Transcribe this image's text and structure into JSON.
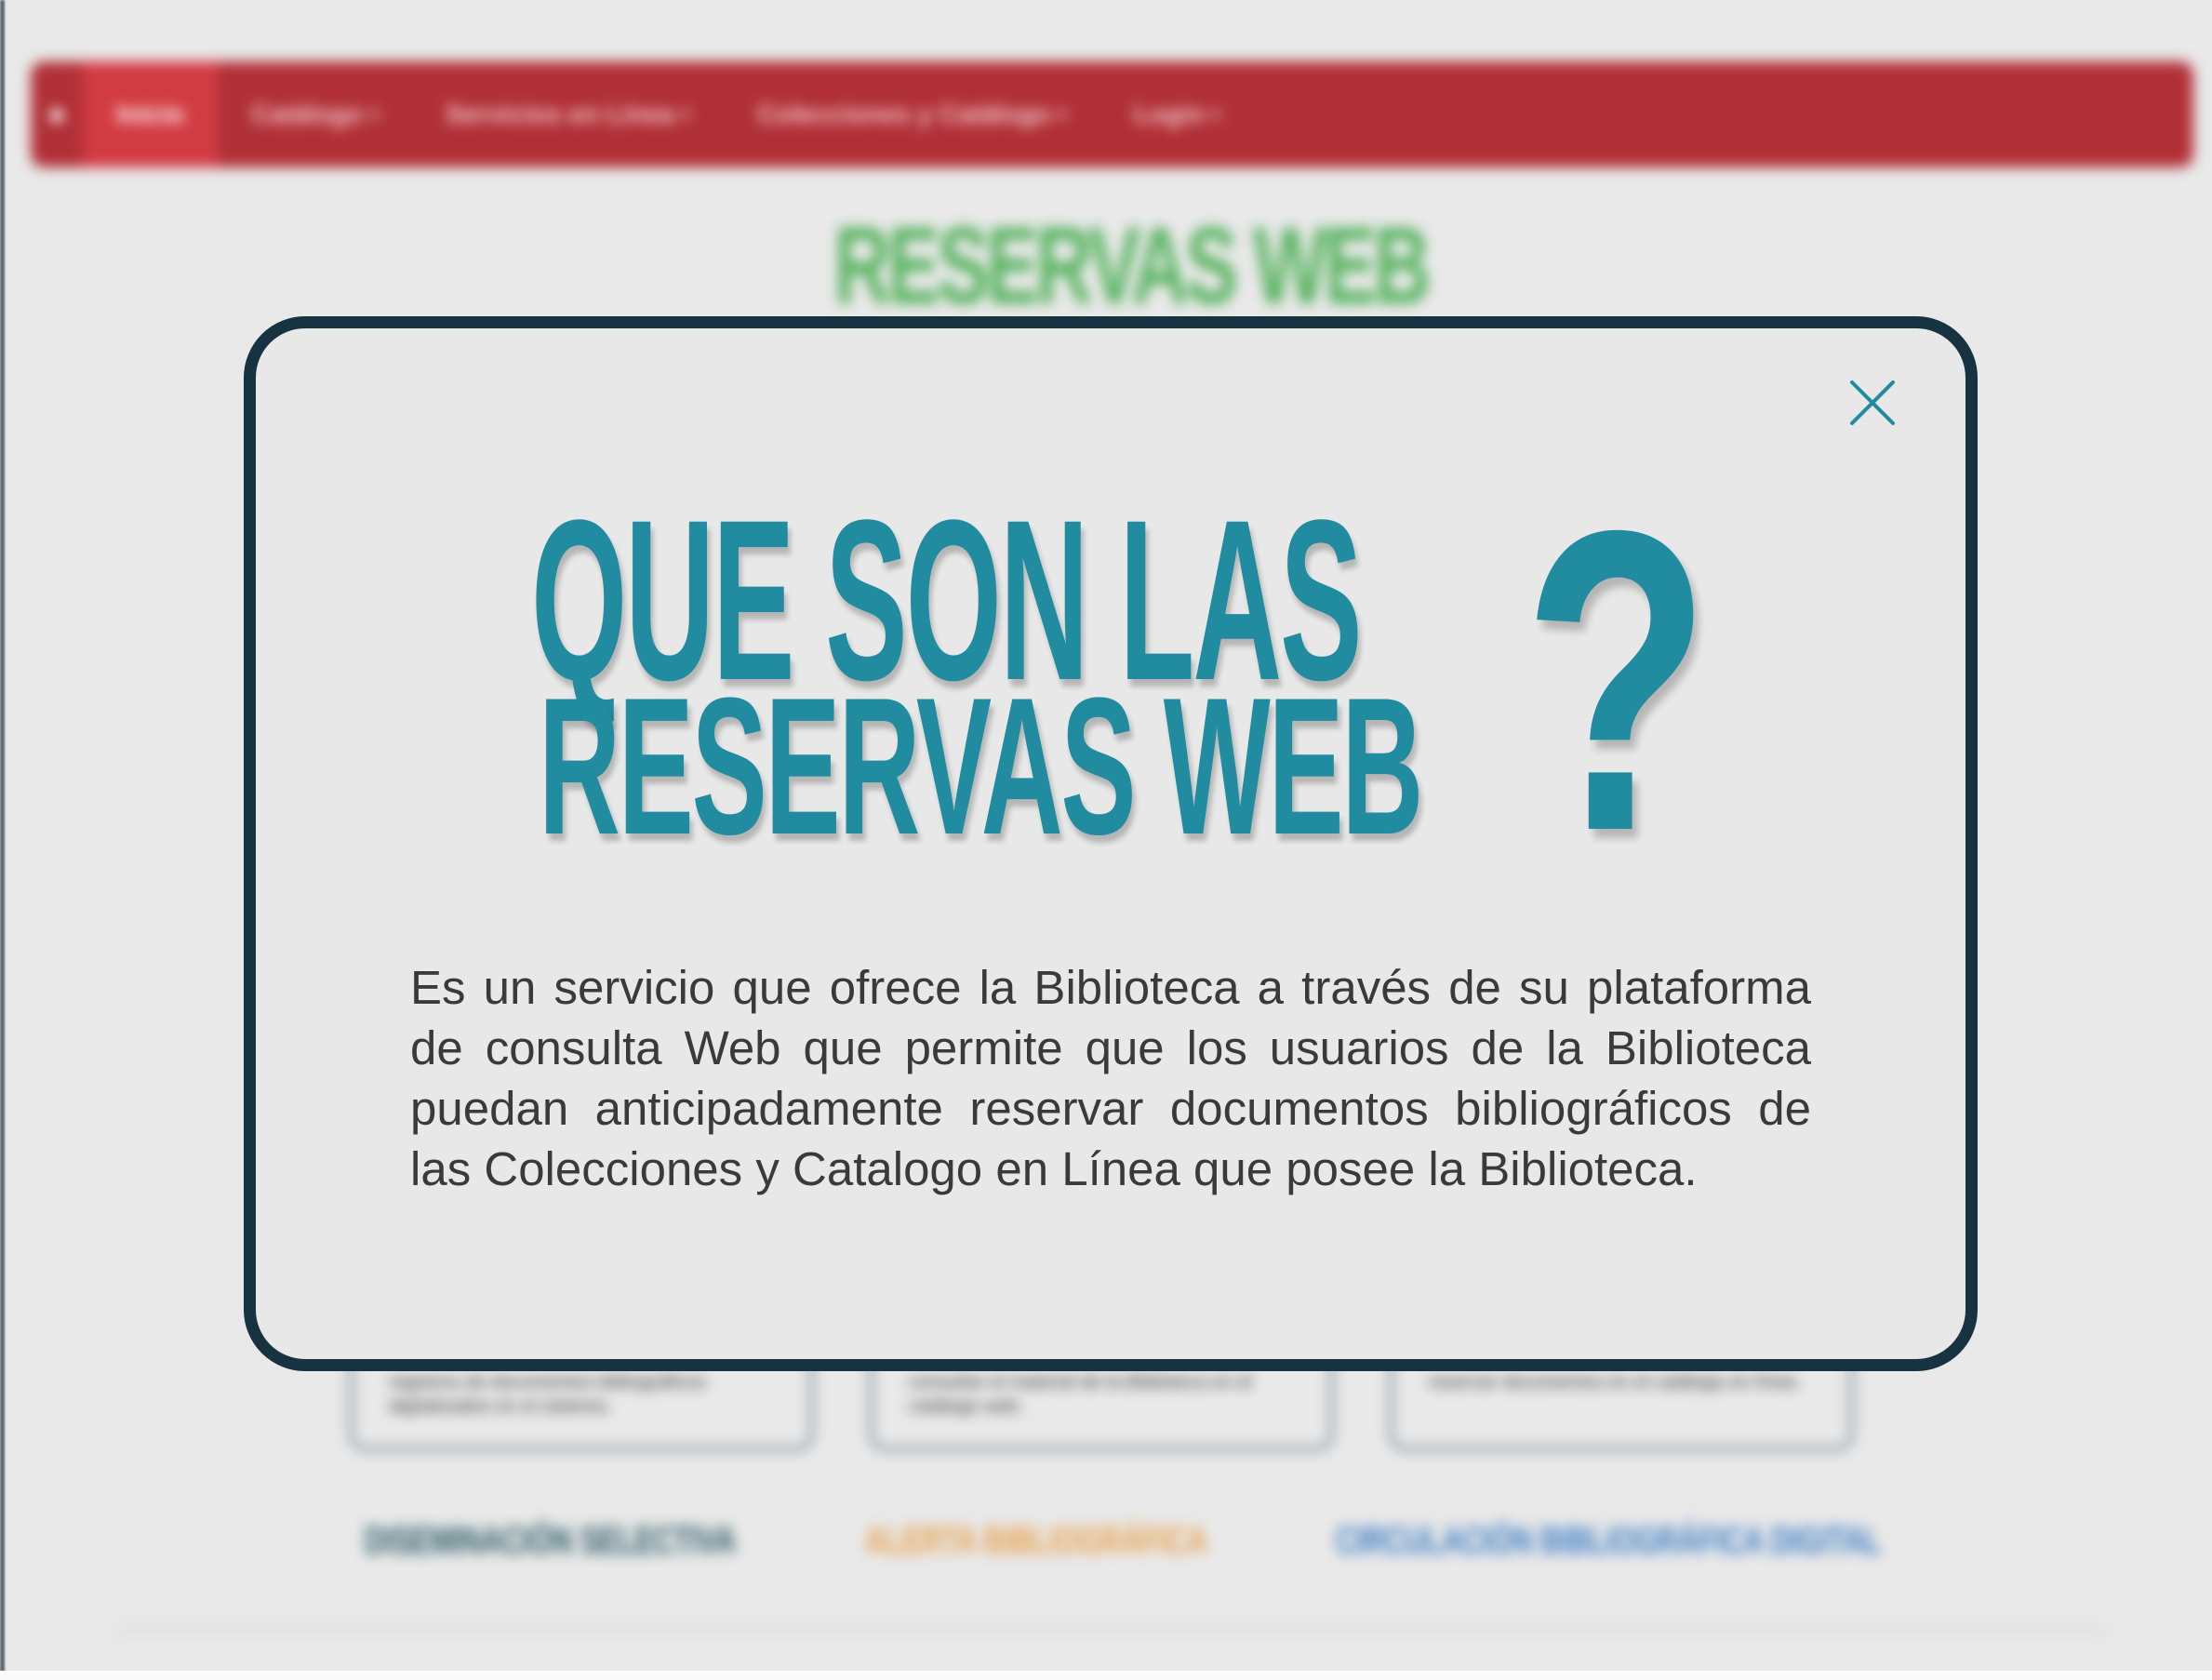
{
  "background": {
    "navbar": {
      "items": [
        {
          "label": "Inicio"
        },
        {
          "label": "Catálogo"
        },
        {
          "label": "Servicios en Línea"
        },
        {
          "label": "Colecciones y Catálogo"
        },
        {
          "label": "Login"
        }
      ]
    },
    "page_title": "RESERVAS WEB",
    "cards": [
      {
        "text": "registros de documentos bibliográficos digitalizados en el sistema."
      },
      {
        "text": "consultar el material de la Biblioteca en el catálogo web."
      },
      {
        "text": "reservar documentos en el catálogo en línea."
      }
    ],
    "links": [
      {
        "label": "DISEMINACIÓN SELECTIVA",
        "color": "#2c5a66"
      },
      {
        "label": "ALERTA BIBLIOGRÁFICA",
        "color": "#e8a04c"
      },
      {
        "label": "CIRCULACIÓN BIBLIOGRÁFICA DIGITAL",
        "color": "#3b7cc4"
      }
    ]
  },
  "modal": {
    "close_icon": "close-icon",
    "heading_line1": "QUE SON LAS",
    "heading_line2": "RESERVAS WEB",
    "question_mark": "?",
    "body": "Es un servicio que ofrece la Biblioteca a través de su plataforma de consulta Web que permite que los usuarios de la Biblioteca puedan anticipadamente reservar documentos bibliográficos de las Colecciones y Catalogo en Línea que posee la Biblioteca.",
    "colors": {
      "heading": "#218ba0",
      "border": "#173240",
      "body_text": "#3a3a3a"
    }
  }
}
